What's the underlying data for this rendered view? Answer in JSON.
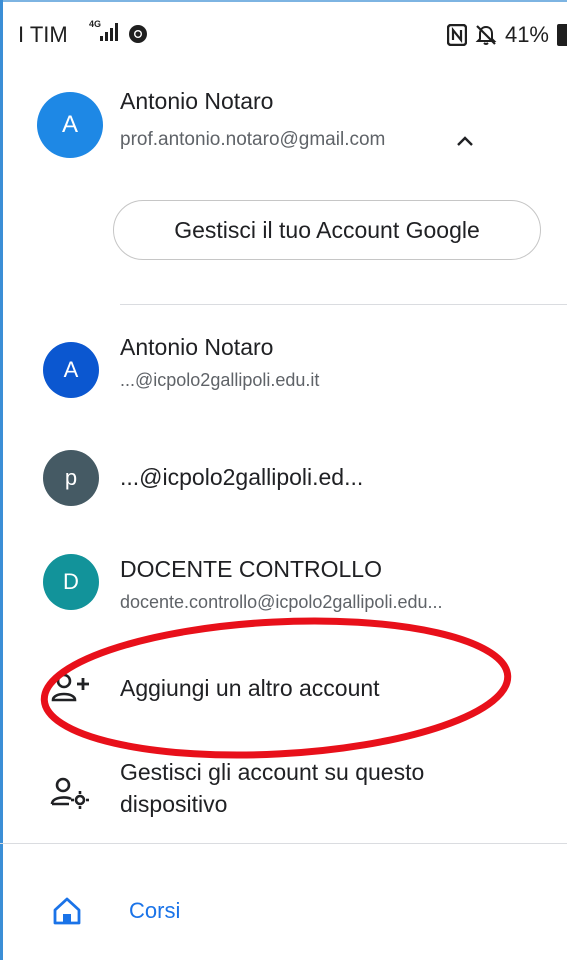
{
  "status_bar": {
    "carrier": "I TIM",
    "network": "4G",
    "battery": "41%"
  },
  "primary_account": {
    "initial": "A",
    "name": "Antonio Notaro",
    "email": "prof.antonio.notaro@gmail.com",
    "avatar_color": "#1e88e5"
  },
  "manage_account_button": "Gestisci il tuo Account Google",
  "other_accounts": [
    {
      "initial": "A",
      "name": "Antonio Notaro",
      "email": "...@icpolo2gallipoli.edu.it",
      "avatar_color": "#0b57d0"
    },
    {
      "initial": "p",
      "name": "...@icpolo2gallipoli.ed...",
      "email": "",
      "avatar_color": "#455a64"
    },
    {
      "initial": "D",
      "name": "DOCENTE CONTROLLO",
      "email": "docente.controllo@icpolo2gallipoli.edu...",
      "avatar_color": "#12939a"
    }
  ],
  "actions": {
    "add_account": "Aggiungi un altro account",
    "manage_device_accounts_line1": "Gestisci gli account su questo",
    "manage_device_accounts_line2": "dispositivo"
  },
  "nav": {
    "corsi": "Corsi"
  },
  "colors": {
    "accent": "#1a73e8",
    "annotation": "#e8101a"
  }
}
